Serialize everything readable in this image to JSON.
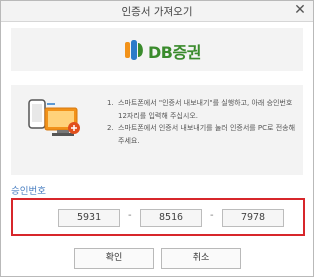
{
  "window": {
    "title": "인증서 가져오기",
    "close_glyph": "✕"
  },
  "brand": {
    "name": "DB증권",
    "colors": {
      "green": "#3a8b2c",
      "orange": "#f29219",
      "blue": "#2a7ac8"
    }
  },
  "instructions": [
    {
      "num": "1.",
      "text": "스마트폰에서 \"인증서 내보내기\"를 실행하고, 아래 승인번호 12자리를 입력해 주십시오."
    },
    {
      "num": "2.",
      "text": "스마트폰에서 인증서 내보내기를 눌러 인증서를 PC로 전송해 주세요."
    }
  ],
  "approval": {
    "label": "승인번호",
    "codes": [
      "5931",
      "8516",
      "7978"
    ],
    "separator": "-"
  },
  "buttons": {
    "confirm": "확인",
    "cancel": "취소"
  },
  "icons": {
    "illustration": "phone-to-pc-transfer-icon",
    "close": "close-icon"
  }
}
